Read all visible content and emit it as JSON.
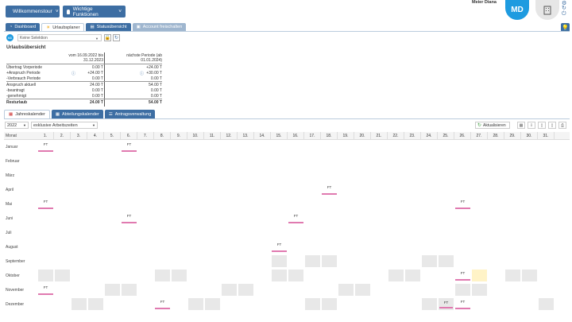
{
  "header": {
    "tour_btn": "Willkommenstour",
    "features_btn": "Wichtige Funktionen",
    "username": "Meier Diana",
    "avatar_initials": "MD"
  },
  "tabs": [
    {
      "label": "Dashboard",
      "active": false
    },
    {
      "label": "Urlaubsplaner",
      "active": true
    },
    {
      "label": "Statusübersicht",
      "active": false
    },
    {
      "label": "Account freischalten",
      "active": false
    }
  ],
  "employee": {
    "badge": "MD",
    "select_value": "Keine Selektion"
  },
  "overview": {
    "title": "Urlaubsübersicht",
    "col1": "vom 16.09.2022 bis 31.12.2023",
    "col2a": "nächste Periode (ab",
    "col2b": "01.01.2024)",
    "rows": [
      {
        "label": "Übertrag Vorperiode",
        "cur": "0.00 T",
        "next": "+24.00 T"
      },
      {
        "label": "+Anspruch Periode",
        "cur": "+24.00 T",
        "next": "+30.00 T"
      },
      {
        "label": "-Verbrauch Periode",
        "cur": "0.00 T",
        "next": "0.00 T"
      },
      {
        "label": "Anspruch aktuell",
        "cur": "24.00 T",
        "next": "54.00 T"
      },
      {
        "label": "-beantragt",
        "cur": "0.00 T",
        "next": "0.00 T"
      },
      {
        "label": "-genehmigt",
        "cur": "0.00 T",
        "next": "0.00 T"
      },
      {
        "label": "Resturlaub",
        "cur": "24.00 T",
        "next": "54.00 T"
      }
    ]
  },
  "subtabs": [
    {
      "label": "Jahreskalender",
      "active": true
    },
    {
      "label": "Abteilungskalender",
      "active": false
    },
    {
      "label": "Antragsverwaltung",
      "active": false
    }
  ],
  "calendar_controls": {
    "year": "2022",
    "mode": "exklusive Arbeitszeiten",
    "refresh": "Aktualisieren"
  },
  "calendar": {
    "month_header": "Monat",
    "holiday_label": "FT",
    "months": [
      {
        "name": "Januar",
        "ft": [
          1,
          6
        ],
        "grey": [],
        "yellow": []
      },
      {
        "name": "Februar",
        "ft": [],
        "grey": [],
        "yellow": []
      },
      {
        "name": "März",
        "ft": [],
        "grey": [],
        "yellow": []
      },
      {
        "name": "April",
        "ft": [
          18
        ],
        "grey": [],
        "yellow": []
      },
      {
        "name": "Mai",
        "ft": [
          1,
          26
        ],
        "grey": [],
        "yellow": []
      },
      {
        "name": "Juni",
        "ft": [
          6,
          16
        ],
        "grey": [],
        "yellow": []
      },
      {
        "name": "Juli",
        "ft": [],
        "grey": [],
        "yellow": []
      },
      {
        "name": "August",
        "ft": [
          15
        ],
        "grey": [],
        "yellow": []
      },
      {
        "name": "September",
        "ft": [],
        "grey": [
          15,
          17,
          18,
          24,
          25
        ],
        "yellow": []
      },
      {
        "name": "Oktober",
        "ft": [
          26
        ],
        "grey": [
          1,
          2,
          8,
          9,
          15,
          16,
          22,
          23,
          29,
          30
        ],
        "yellow": [
          27
        ]
      },
      {
        "name": "November",
        "ft": [
          1
        ],
        "grey": [
          5,
          6,
          12,
          13,
          19,
          20,
          26,
          27
        ],
        "yellow": []
      },
      {
        "name": "Dezember",
        "ft": [
          8,
          25,
          26
        ],
        "grey": [
          3,
          4,
          10,
          11,
          17,
          18,
          24,
          25,
          31
        ],
        "yellow": []
      }
    ]
  }
}
